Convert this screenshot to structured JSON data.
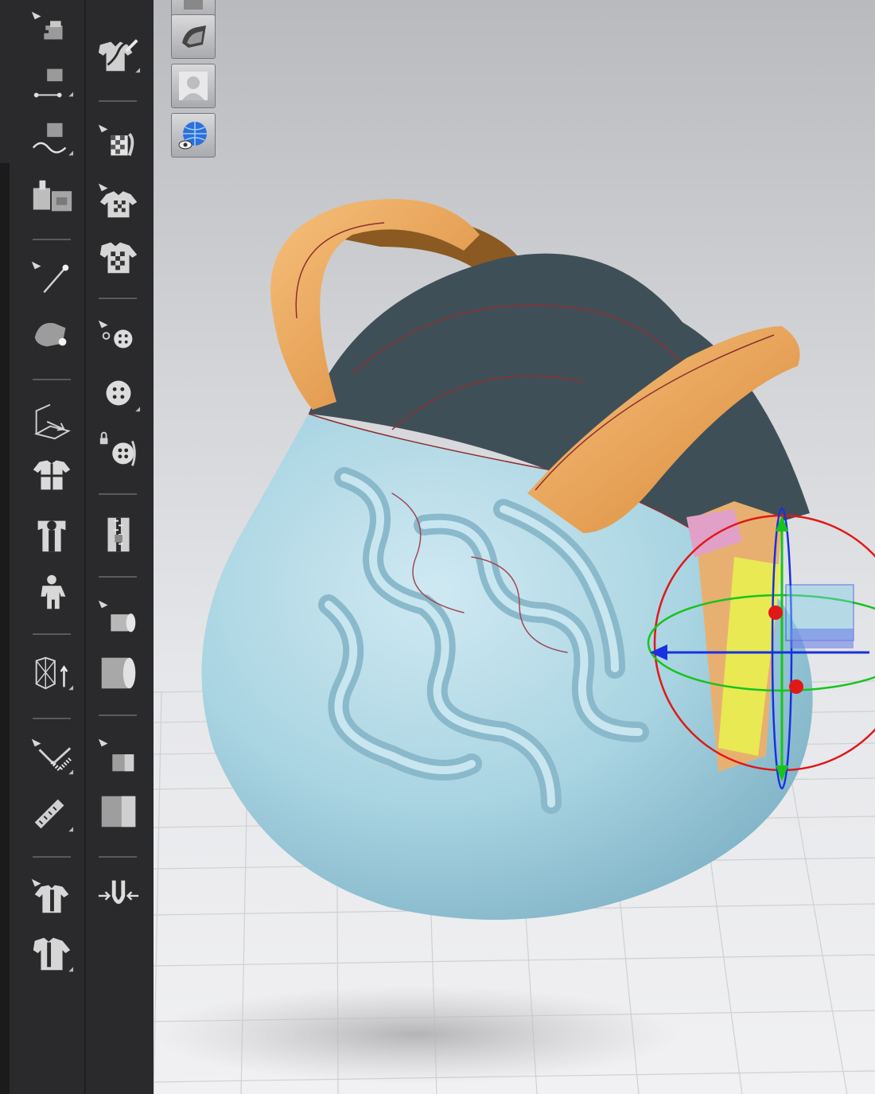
{
  "app": {
    "toolbar": {
      "left_column": [
        {
          "name": "sewing-tool-icon"
        },
        {
          "name": "segment-sewing-icon"
        },
        {
          "name": "free-sewing-icon"
        },
        {
          "name": "multi-sewing-icon"
        },
        {
          "name": "pin-tool-icon"
        },
        {
          "name": "tack-tool-icon"
        },
        {
          "name": "arrangement-icon"
        },
        {
          "name": "garment-arrange-icon"
        },
        {
          "name": "avatar-fit-icon"
        },
        {
          "name": "avatar-icon"
        },
        {
          "name": "mesh-info-icon"
        },
        {
          "name": "measure-tool-icon"
        },
        {
          "name": "tape-measure-icon"
        },
        {
          "name": "garment-measure-icon"
        },
        {
          "name": "garment-grade-icon"
        }
      ],
      "right_column": [
        {
          "name": "pattern-edit-icon"
        },
        {
          "name": "texture-edit-icon"
        },
        {
          "name": "graphic-select-icon"
        },
        {
          "name": "graphic-icon"
        },
        {
          "name": "button-select-icon"
        },
        {
          "name": "button-icon"
        },
        {
          "name": "buttonhole-icon"
        },
        {
          "name": "zipper-icon"
        },
        {
          "name": "fabric-roll-select-icon"
        },
        {
          "name": "fabric-roll-icon"
        },
        {
          "name": "fabric-swatch-select-icon"
        },
        {
          "name": "fabric-swatch-icon"
        },
        {
          "name": "fold-tool-icon"
        }
      ]
    },
    "viewport_tools": [
      {
        "name": "shading-mode-icon"
      },
      {
        "name": "avatar-visibility-icon"
      },
      {
        "name": "world-view-icon"
      }
    ],
    "colors": {
      "toolbar_bg": "#2a2a2c",
      "viewport_top": "#b9babd",
      "viewport_bottom": "#f1f1f3",
      "bag_body": "#a9d4e2",
      "bag_interior": "#3f4f57",
      "strap": "#e9a85c",
      "gizmo_x": "#e01818",
      "gizmo_y": "#18c41c",
      "gizmo_z": "#1830e0"
    }
  }
}
